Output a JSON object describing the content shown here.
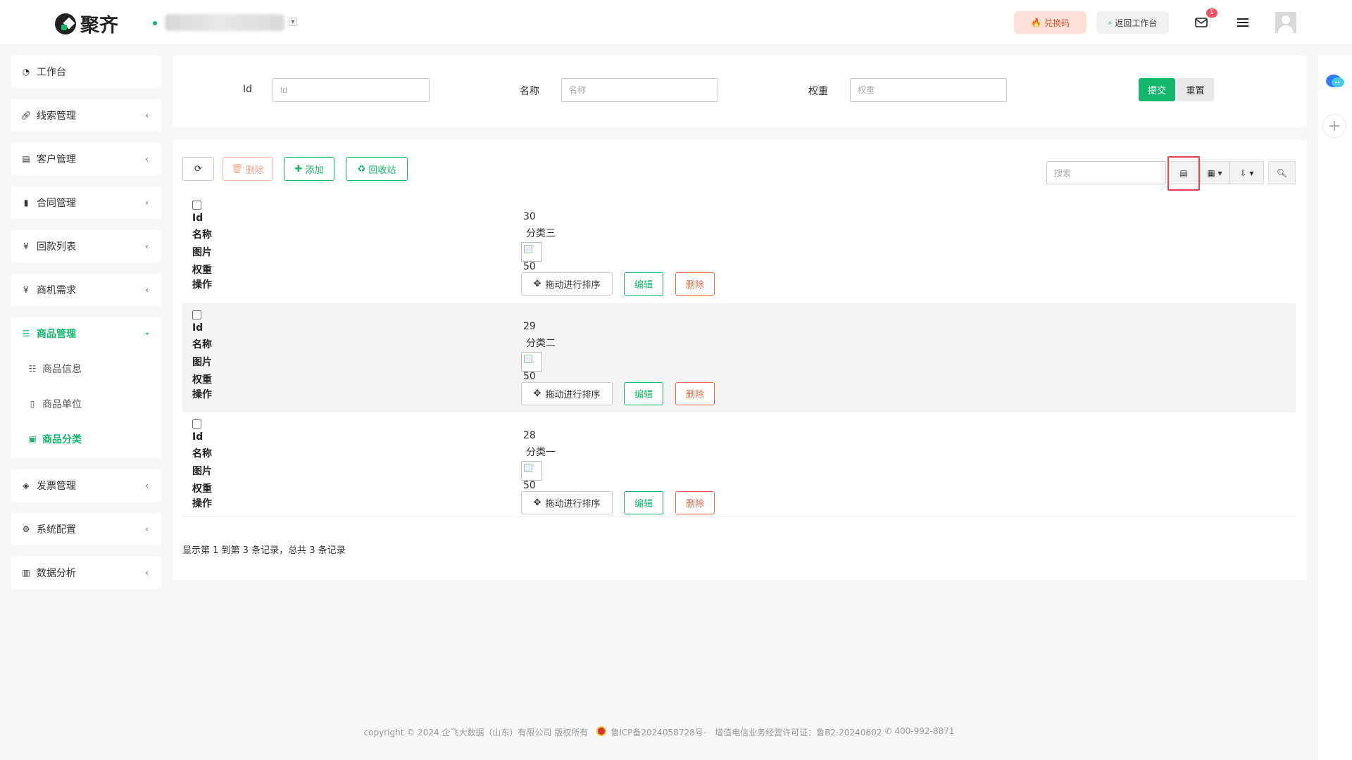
{
  "header": {
    "logo_text": "聚齐",
    "redeem_label": "兑换码",
    "back_label": "返回工作台",
    "mail_badge": "1"
  },
  "sidebar": {
    "items": [
      {
        "label": "工作台",
        "icon": "dashboard-icon"
      },
      {
        "label": "线索管理",
        "icon": "link-icon"
      },
      {
        "label": "客户管理",
        "icon": "id-card-icon"
      },
      {
        "label": "合同管理",
        "icon": "bookmark-icon"
      },
      {
        "label": "回款列表",
        "icon": "yen-icon"
      },
      {
        "label": "商机需求",
        "icon": "yen-icon"
      },
      {
        "label": "商品管理",
        "icon": "list-icon"
      },
      {
        "label": "发票管理",
        "icon": "tag-icon"
      },
      {
        "label": "系统配置",
        "icon": "gears-icon"
      },
      {
        "label": "数据分析",
        "icon": "bar-chart-icon"
      }
    ],
    "sub_items": [
      {
        "label": "商品信息",
        "icon": "list-indent-icon"
      },
      {
        "label": "商品单位",
        "icon": "file-icon"
      },
      {
        "label": "商品分类",
        "icon": "calendar-icon"
      }
    ],
    "active_sub": "商品分类"
  },
  "form": {
    "id_label": "Id",
    "id_placeholder": "Id",
    "name_label": "名称",
    "name_placeholder": "名称",
    "weight_label": "权重",
    "weight_placeholder": "权重",
    "submit_label": "提交",
    "reset_label": "重置"
  },
  "toolbar": {
    "delete_label": "删除",
    "add_label": "添加",
    "recycle_label": "回收站",
    "search_placeholder": "搜索"
  },
  "table": {
    "field_labels": {
      "id": "Id",
      "name": "名称",
      "image": "图片",
      "weight": "权重",
      "ops": "操作"
    },
    "drag_label": "拖动进行排序",
    "edit_label": "编辑",
    "delete_label": "删除",
    "rows": [
      {
        "id": "30",
        "name": "分类三",
        "weight": "50"
      },
      {
        "id": "29",
        "name": "分类二",
        "weight": "50"
      },
      {
        "id": "28",
        "name": "分类一",
        "weight": "50"
      }
    ],
    "paging_text": "显示第 1 到第 3 条记录，总共 3 条记录"
  },
  "footer": {
    "copyright": "copyright © 2024 企飞大数据（山东）有限公司 版权所有",
    "icp": "鲁ICP备2024058728号-",
    "license": "增值电信业务经营许可证：鲁B2-20240602",
    "phone": "400-992-8871"
  },
  "colors": {
    "accent": "#13b86a",
    "danger": "#e86a4a",
    "highlight": "#e5424d"
  }
}
